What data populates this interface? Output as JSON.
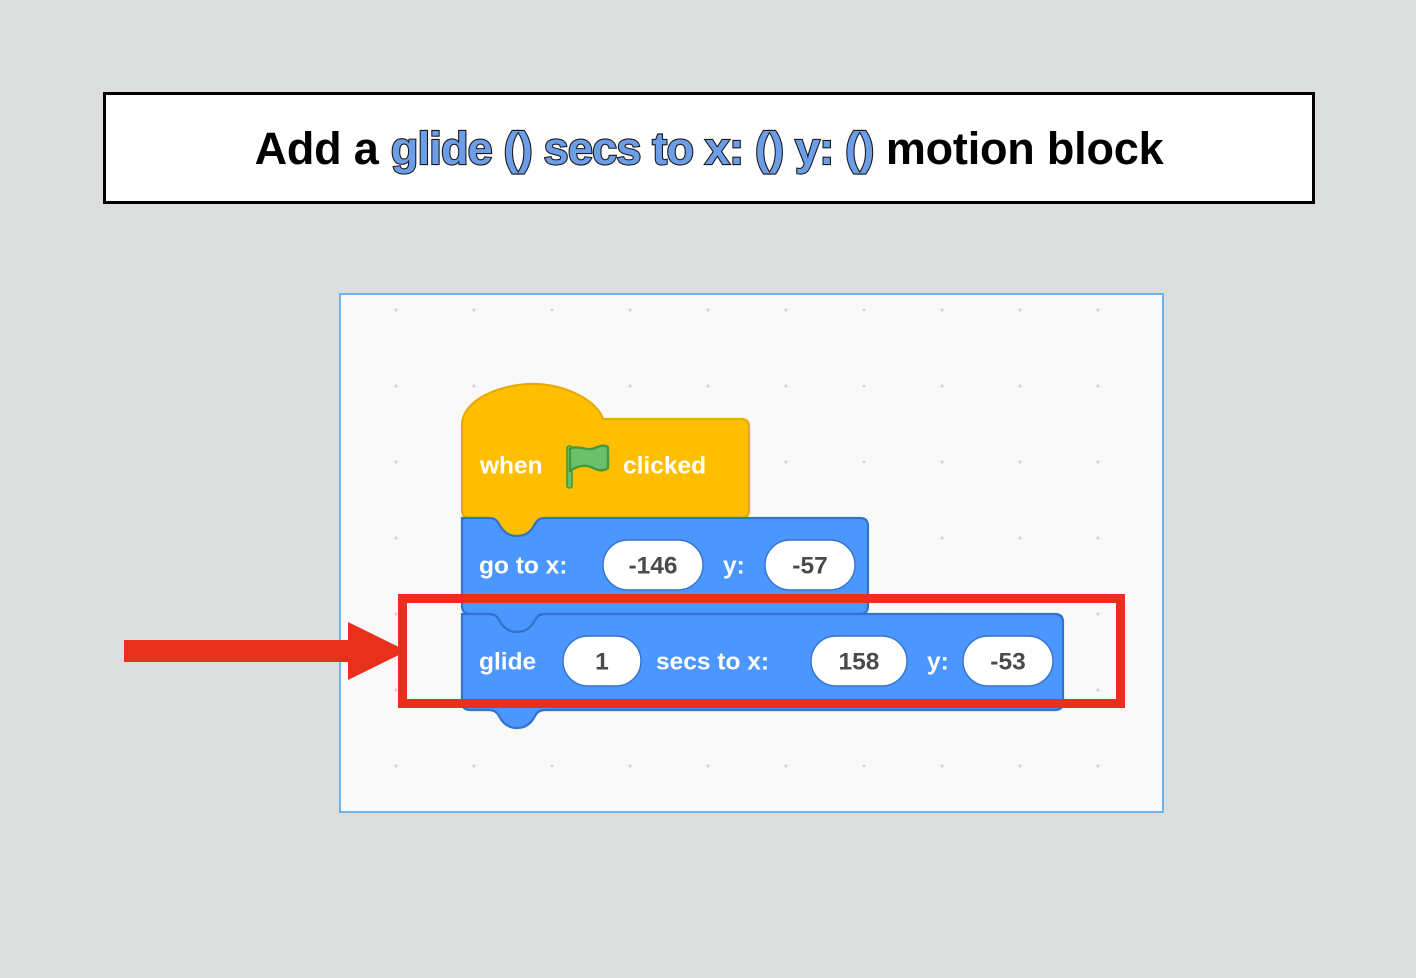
{
  "page": {
    "background_color": "#dcdddd"
  },
  "title": {
    "prefix": "Add a ",
    "block_name": "glide () secs to x: () y: ()",
    "suffix": " motion block",
    "text_color": "#000000",
    "block_name_color": "#6c9ee8",
    "box_background": "#ffffff",
    "box_border_color": "#000000"
  },
  "workspace": {
    "background_color": "#f9f9f9",
    "border_color": "#6cb5ef",
    "grid_dot_color": "#d7d7d7"
  },
  "annotation": {
    "rect_color": "#e8301d",
    "arrow_color": "#e8301d",
    "arrow_direction": "right",
    "target": "glide-block"
  },
  "script": {
    "blocks": [
      {
        "id": "when-flag-clicked",
        "type": "hat",
        "category": "events",
        "color": "#ffbf00",
        "outline_color": "#e6ab00",
        "label_before": "when",
        "icon": "green-flag-icon",
        "label_after": "clicked"
      },
      {
        "id": "go-to-xy",
        "type": "stack",
        "category": "motion",
        "color": "#4c97ff",
        "outline_color": "#3373cc",
        "label_x": "go to x:",
        "value_x": "-146",
        "label_y": "y:",
        "value_y": "-57"
      },
      {
        "id": "glide-secs-to-xy",
        "type": "stack",
        "category": "motion",
        "color": "#4c97ff",
        "outline_color": "#3373cc",
        "label_glide": "glide",
        "value_secs": "1",
        "label_secs": "secs to x:",
        "value_x": "158",
        "label_y": "y:",
        "value_y": "-53",
        "highlighted": "true"
      }
    ]
  },
  "icons": {
    "green_flag": {
      "name": "green-flag-icon",
      "fill": "#6bc06b",
      "stroke": "#45993d"
    }
  }
}
